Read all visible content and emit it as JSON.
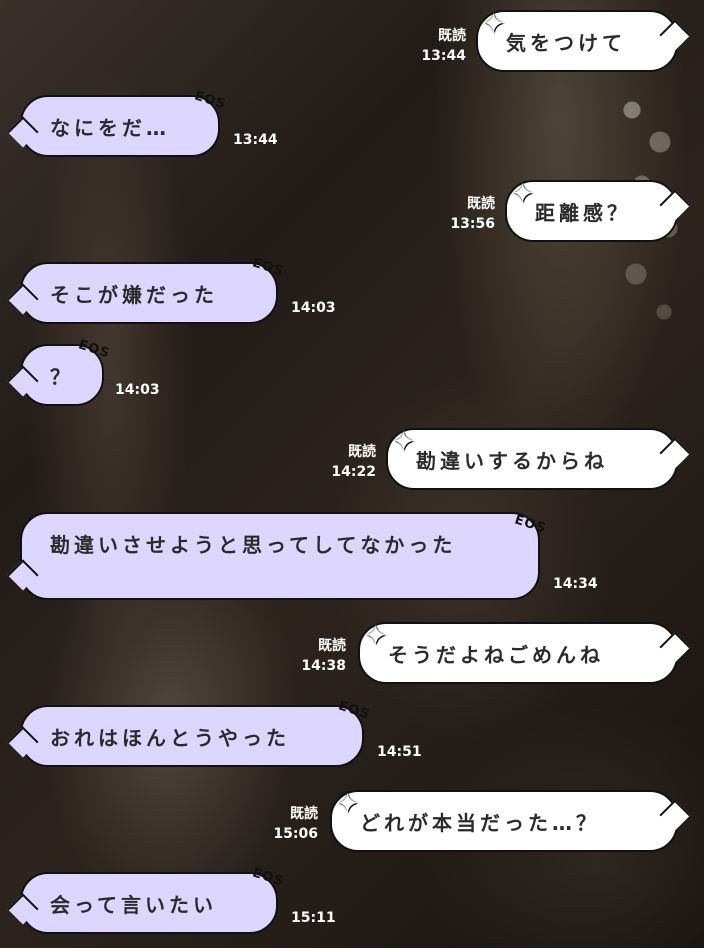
{
  "messages": [
    {
      "side": "right",
      "text": "気をつけて",
      "read": "既読",
      "time": "13:44"
    },
    {
      "side": "left",
      "text": "なにをだ…",
      "time": "13:44"
    },
    {
      "side": "right",
      "text": "距離感？",
      "read": "既読",
      "time": "13:56"
    },
    {
      "side": "left",
      "text": "そこが嫌だった",
      "time": "14:03"
    },
    {
      "side": "left",
      "text": "？",
      "time": "14:03"
    },
    {
      "side": "right",
      "text": "勘違いするからね",
      "read": "既読",
      "time": "14:22"
    },
    {
      "side": "left",
      "text": "勘違いさせようと思ってしてなかった",
      "time": "14:34"
    },
    {
      "side": "right",
      "text": "そうだよねごめんね",
      "read": "既読",
      "time": "14:38"
    },
    {
      "side": "left",
      "text": "おれはほんとうやった",
      "time": "14:51"
    },
    {
      "side": "right",
      "text": "どれが本当だった…？",
      "read": "既読",
      "time": "15:06"
    },
    {
      "side": "left",
      "text": "会って言いたい",
      "time": "15:11"
    }
  ],
  "decorations": {
    "left_badge": "EOS",
    "right_sparkle": "✦"
  },
  "colors": {
    "left_bubble": "#ddd7ff",
    "right_bubble": "#ffffff",
    "text": "#2b2b2b",
    "meta": "#ffffff"
  }
}
